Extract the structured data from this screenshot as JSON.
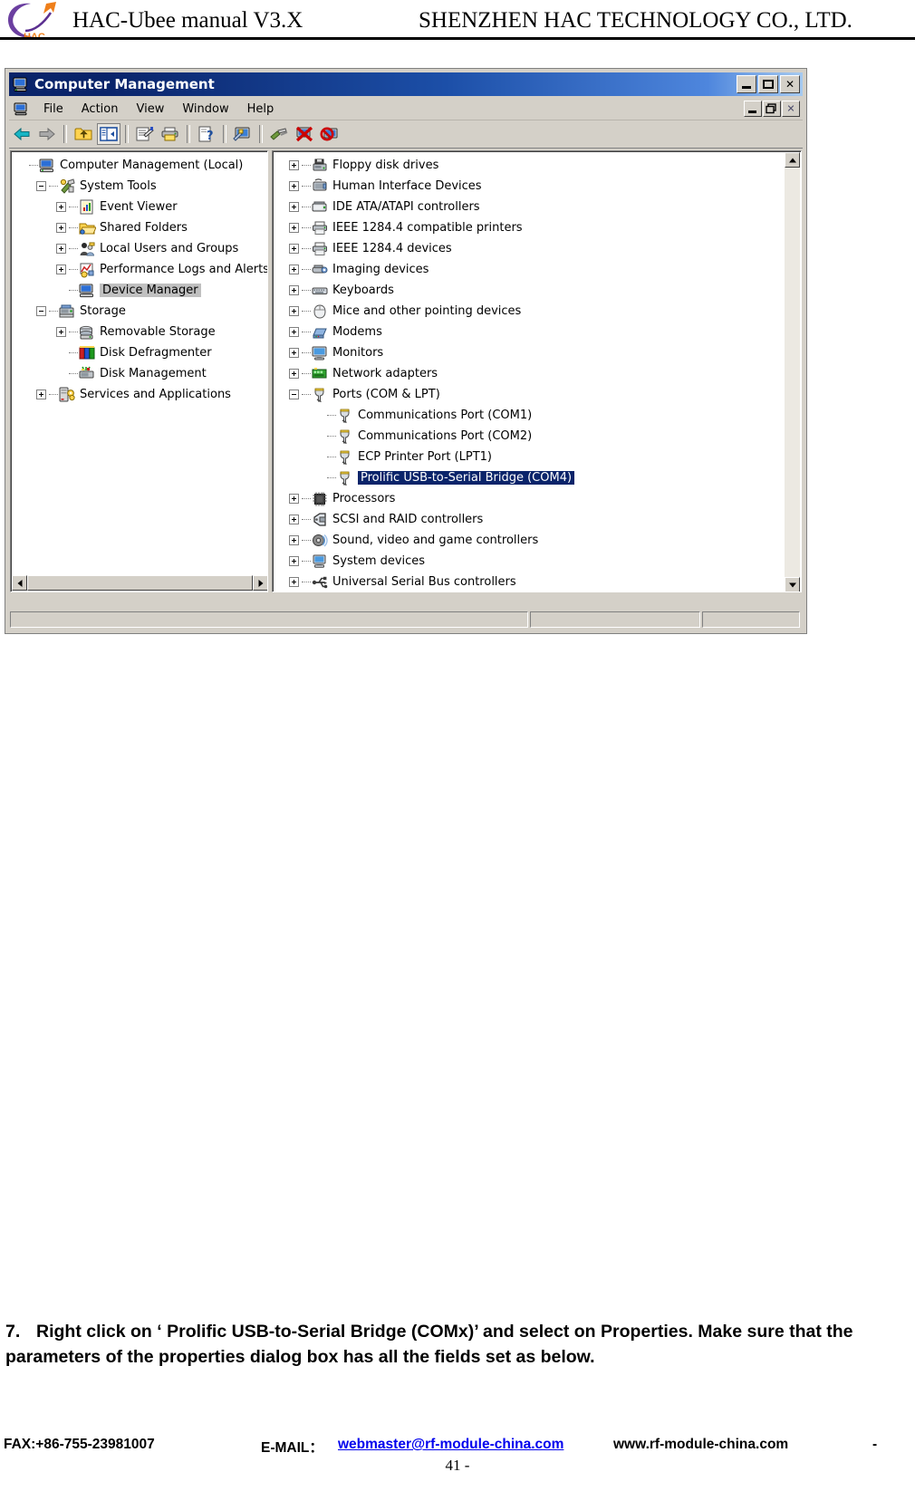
{
  "document": {
    "header": {
      "logo_alt": "HAC logo",
      "logo_text": "HAC",
      "title": "HAC-Ubee manual V3.X",
      "company": "SHENZHEN HAC TECHNOLOGY CO., LTD."
    },
    "instruction": {
      "number": "7.",
      "text": "Right click on ‘ Prolific USB-to-Serial Bridge (COMx)’ and select on Properties. Make sure that the parameters of the properties dialog box has all the fields set as below."
    },
    "footer": {
      "fax": "FAX:+86-755-23981007",
      "email_label": "E-MAIL：",
      "email": "webmaster@rf-module-china.com",
      "website": "www.rf-module-china.com",
      "trailing_dash": "-",
      "page": "41 -"
    },
    "colors": {
      "link": "#0000ee",
      "titlebar_start": "#0a246a",
      "titlebar_end": "#a6caf0",
      "selection_blue": "#0a246a",
      "selection_gray": "#c0c0c0",
      "window_face": "#d4d0c8"
    }
  },
  "window": {
    "title": "Computer Management",
    "titlebar_icon": "computer-icon",
    "buttons": {
      "minimize": "minimize-button",
      "maximize": "maximize-button",
      "close": "close-button"
    },
    "mdi_buttons": {
      "minimize": "mdi-minimize-button",
      "restore": "mdi-restore-button",
      "close": "mdi-close-button"
    },
    "menu": [
      "File",
      "Action",
      "View",
      "Window",
      "Help"
    ],
    "toolbar": [
      {
        "name": "back-icon",
        "enabled": true
      },
      {
        "name": "forward-icon",
        "enabled": false
      },
      {
        "name": "up-one-level-icon",
        "enabled": true
      },
      {
        "name": "show-hide-console-tree-icon",
        "enabled": true,
        "pressed": true
      },
      {
        "name": "properties-icon",
        "enabled": true
      },
      {
        "name": "print-icon",
        "enabled": true
      },
      {
        "name": "help-icon",
        "enabled": true
      },
      {
        "name": "scan-for-hardware-changes-icon",
        "enabled": true
      },
      {
        "name": "update-driver-icon",
        "enabled": true
      },
      {
        "name": "disable-device-icon",
        "enabled": true
      },
      {
        "name": "uninstall-device-icon",
        "enabled": true
      }
    ],
    "statusbar": [
      "",
      "",
      ""
    ]
  },
  "console_tree": [
    {
      "label": "Computer Management (Local)",
      "indent": 0,
      "expander": "none",
      "icon": "computer-icon",
      "selected": false
    },
    {
      "label": "System Tools",
      "indent": 1,
      "expander": "minus",
      "icon": "system-tools-icon",
      "selected": false
    },
    {
      "label": "Event Viewer",
      "indent": 2,
      "expander": "plus",
      "icon": "event-viewer-icon",
      "selected": false
    },
    {
      "label": "Shared Folders",
      "indent": 2,
      "expander": "plus",
      "icon": "shared-folders-icon",
      "selected": false
    },
    {
      "label": "Local Users and Groups",
      "indent": 2,
      "expander": "plus",
      "icon": "local-users-icon",
      "selected": false
    },
    {
      "label": "Performance Logs and Alerts",
      "indent": 2,
      "expander": "plus",
      "icon": "performance-logs-icon",
      "selected": false
    },
    {
      "label": "Device Manager",
      "indent": 2,
      "expander": "none",
      "icon": "device-manager-icon",
      "selected": true
    },
    {
      "label": "Storage",
      "indent": 1,
      "expander": "minus",
      "icon": "storage-icon",
      "selected": false
    },
    {
      "label": "Removable Storage",
      "indent": 2,
      "expander": "plus",
      "icon": "removable-storage-icon",
      "selected": false
    },
    {
      "label": "Disk Defragmenter",
      "indent": 2,
      "expander": "none",
      "icon": "disk-defragmenter-icon",
      "selected": false
    },
    {
      "label": "Disk Management",
      "indent": 2,
      "expander": "none",
      "icon": "disk-management-icon",
      "selected": false
    },
    {
      "label": "Services and Applications",
      "indent": 1,
      "expander": "plus",
      "icon": "services-icon",
      "selected": false
    }
  ],
  "device_tree": [
    {
      "label": "Floppy disk drives",
      "indent": 0,
      "expander": "plus",
      "icon": "floppy-drive-icon",
      "selected": false
    },
    {
      "label": "Human Interface Devices",
      "indent": 0,
      "expander": "plus",
      "icon": "hid-icon",
      "selected": false
    },
    {
      "label": "IDE ATA/ATAPI controllers",
      "indent": 0,
      "expander": "plus",
      "icon": "ide-controller-icon",
      "selected": false
    },
    {
      "label": "IEEE 1284.4 compatible printers",
      "indent": 0,
      "expander": "plus",
      "icon": "printer-icon",
      "selected": false
    },
    {
      "label": "IEEE 1284.4 devices",
      "indent": 0,
      "expander": "plus",
      "icon": "printer-icon",
      "selected": false
    },
    {
      "label": "Imaging devices",
      "indent": 0,
      "expander": "plus",
      "icon": "imaging-device-icon",
      "selected": false
    },
    {
      "label": "Keyboards",
      "indent": 0,
      "expander": "plus",
      "icon": "keyboard-icon",
      "selected": false
    },
    {
      "label": "Mice and other pointing devices",
      "indent": 0,
      "expander": "plus",
      "icon": "mouse-icon",
      "selected": false
    },
    {
      "label": "Modems",
      "indent": 0,
      "expander": "plus",
      "icon": "modem-icon",
      "selected": false
    },
    {
      "label": "Monitors",
      "indent": 0,
      "expander": "plus",
      "icon": "monitor-icon",
      "selected": false
    },
    {
      "label": "Network adapters",
      "indent": 0,
      "expander": "plus",
      "icon": "network-adapter-icon",
      "selected": false
    },
    {
      "label": "Ports (COM & LPT)",
      "indent": 0,
      "expander": "minus",
      "icon": "port-icon",
      "selected": false
    },
    {
      "label": "Communications Port (COM1)",
      "indent": 1,
      "expander": "none",
      "icon": "port-icon",
      "selected": false
    },
    {
      "label": "Communications Port (COM2)",
      "indent": 1,
      "expander": "none",
      "icon": "port-icon",
      "selected": false
    },
    {
      "label": "ECP Printer Port (LPT1)",
      "indent": 1,
      "expander": "none",
      "icon": "port-icon",
      "selected": false
    },
    {
      "label": "Prolific USB-to-Serial Bridge (COM4)",
      "indent": 1,
      "expander": "none",
      "icon": "port-icon",
      "selected": true
    },
    {
      "label": "Processors",
      "indent": 0,
      "expander": "plus",
      "icon": "processor-icon",
      "selected": false
    },
    {
      "label": "SCSI and RAID controllers",
      "indent": 0,
      "expander": "plus",
      "icon": "scsi-controller-icon",
      "selected": false
    },
    {
      "label": "Sound, video and game controllers",
      "indent": 0,
      "expander": "plus",
      "icon": "sound-device-icon",
      "selected": false
    },
    {
      "label": "System devices",
      "indent": 0,
      "expander": "plus",
      "icon": "system-device-icon",
      "selected": false
    },
    {
      "label": "Universal Serial Bus controllers",
      "indent": 0,
      "expander": "plus",
      "icon": "usb-controller-icon",
      "selected": false
    }
  ]
}
